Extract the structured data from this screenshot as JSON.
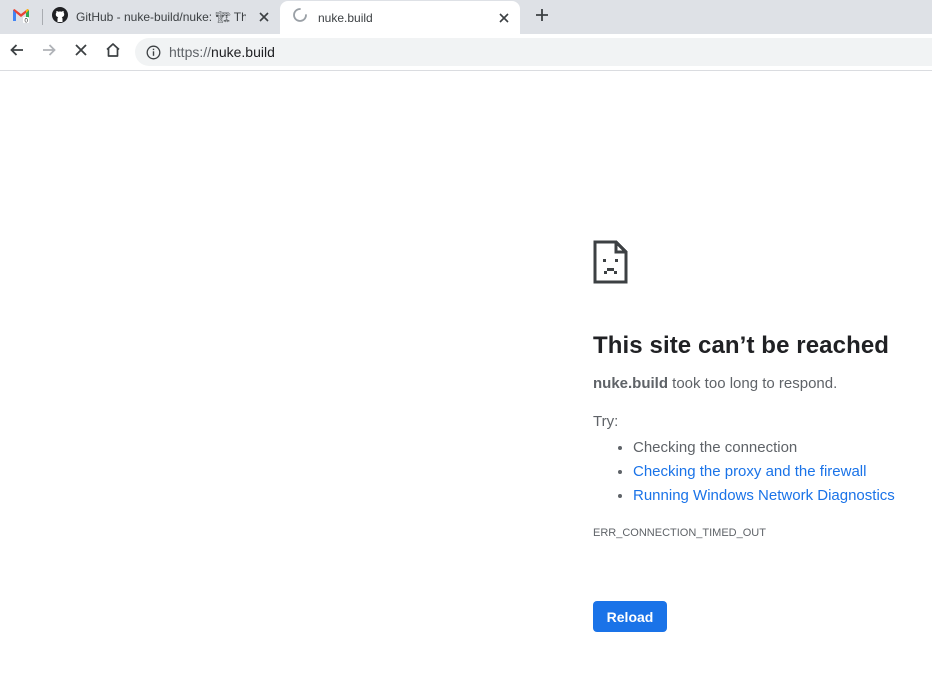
{
  "tabs": [
    {
      "id": "gmail",
      "icon": "gmail-icon"
    },
    {
      "id": "github",
      "title": "GitHub - nuke-build/nuke: 🏗 Th",
      "icon": "github-icon"
    },
    {
      "id": "nuke",
      "title": "nuke.build",
      "icon": "loading-spinner-icon",
      "active": true
    }
  ],
  "toolbar": {
    "url_scheme": "https://",
    "url_host": "nuke.build"
  },
  "error": {
    "title": "This site can’t be reached",
    "host": "nuke.build",
    "message": " took too long to respond.",
    "try_label": "Try:",
    "suggestions": [
      "Checking the connection",
      "Checking the proxy and the firewall",
      "Running Windows Network Diagnostics"
    ],
    "code": "ERR_CONNECTION_TIMED_OUT",
    "reload_label": "Reload"
  },
  "colors": {
    "accent": "#1a73e8",
    "tabstrip": "#dee1e6",
    "text": "#202124",
    "secondary_text": "#5f6368"
  }
}
